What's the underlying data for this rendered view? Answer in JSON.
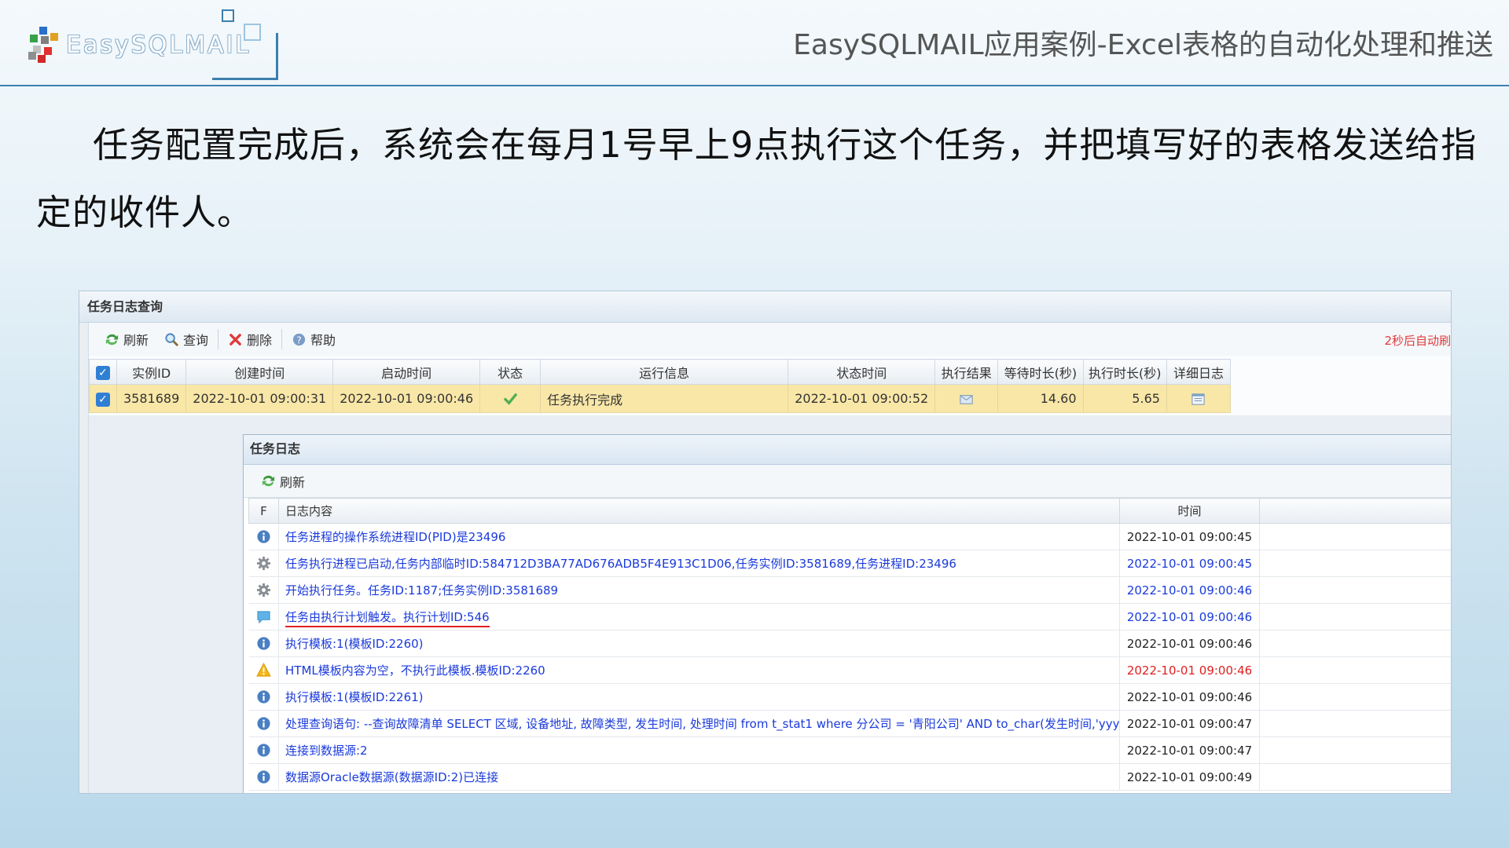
{
  "slide": {
    "logo_text": "EasySQLMAIL",
    "title": "EasySQLMAIL应用案例-Excel表格的自动化处理和推送",
    "paragraph": "任务配置完成后，系统会在每月1号早上9点执行这个任务，并把填写好的表格发送给指定的收件人。"
  },
  "window": {
    "title": "任务日志查询",
    "toolbar": {
      "refresh": "刷新",
      "query": "查询",
      "delete": "删除",
      "help": "帮助",
      "auto_refresh": "2秒后自动刷"
    },
    "columns": [
      "实例ID",
      "创建时间",
      "启动时间",
      "状态",
      "运行信息",
      "状态时间",
      "执行结果",
      "等待时长(秒)",
      "执行时长(秒)",
      "详细日志"
    ],
    "row": {
      "instance_id": "3581689",
      "created": "2022-10-01 09:00:31",
      "started": "2022-10-01 09:00:46",
      "status_icon": "check-icon",
      "run_info": "任务执行完成",
      "status_time": "2022-10-01 09:00:52",
      "result_icon": "mail-icon",
      "wait_seconds": "14.60",
      "exec_seconds": "5.65",
      "detail_icon": "log-detail-icon"
    }
  },
  "dialog": {
    "title": "任务日志",
    "refresh": "刷新",
    "col_flag": "F",
    "col_content": "日志内容",
    "col_time": "时间",
    "logs": [
      {
        "icon": "info-icon",
        "text": "任务进程的操作系统进程ID(PID)是23496",
        "time": "2022-10-01 09:00:45",
        "time_color": "black"
      },
      {
        "icon": "gear-icon",
        "text": "任务执行进程已启动,任务内部临时ID:584712D3BA77AD676ADB5F4E913C1D06,任务实例ID:3581689,任务进程ID:23496",
        "time": "2022-10-01 09:00:45",
        "time_color": "blue"
      },
      {
        "icon": "gear-icon",
        "text": "开始执行任务。任务ID:1187;任务实例ID:3581689",
        "time": "2022-10-01 09:00:46",
        "time_color": "blue"
      },
      {
        "icon": "chat-icon",
        "text": "任务由执行计划触发。执行计划ID:546",
        "time": "2022-10-01 09:00:46",
        "time_color": "blue"
      },
      {
        "icon": "info-icon",
        "text": "执行模板:1(模板ID:2260)",
        "time": "2022-10-01 09:00:46",
        "time_color": "black"
      },
      {
        "icon": "warning-icon",
        "text": "HTML模板内容为空，不执行此模板.模板ID:2260",
        "time": "2022-10-01 09:00:46",
        "time_color": "red"
      },
      {
        "icon": "info-icon",
        "text": "执行模板:1(模板ID:2261)",
        "time": "2022-10-01 09:00:46",
        "time_color": "black"
      },
      {
        "icon": "info-icon",
        "text": "处理查询语句: --查询故障清单 SELECT 区域, 设备地址, 故障类型, 发生时间, 处理时间 from t_stat1 where 分公司 = '青阳公司' AND to_char(发生时间,'yyyymm') = to_char(add_mo",
        "time": "2022-10-01 09:00:47",
        "time_color": "black"
      },
      {
        "icon": "info-icon",
        "text": "连接到数据源:2",
        "time": "2022-10-01 09:00:47",
        "time_color": "black"
      },
      {
        "icon": "info-icon",
        "text": "数据源Oracle数据源(数据源ID:2)已连接",
        "time": "2022-10-01 09:00:49",
        "time_color": "black"
      }
    ]
  }
}
